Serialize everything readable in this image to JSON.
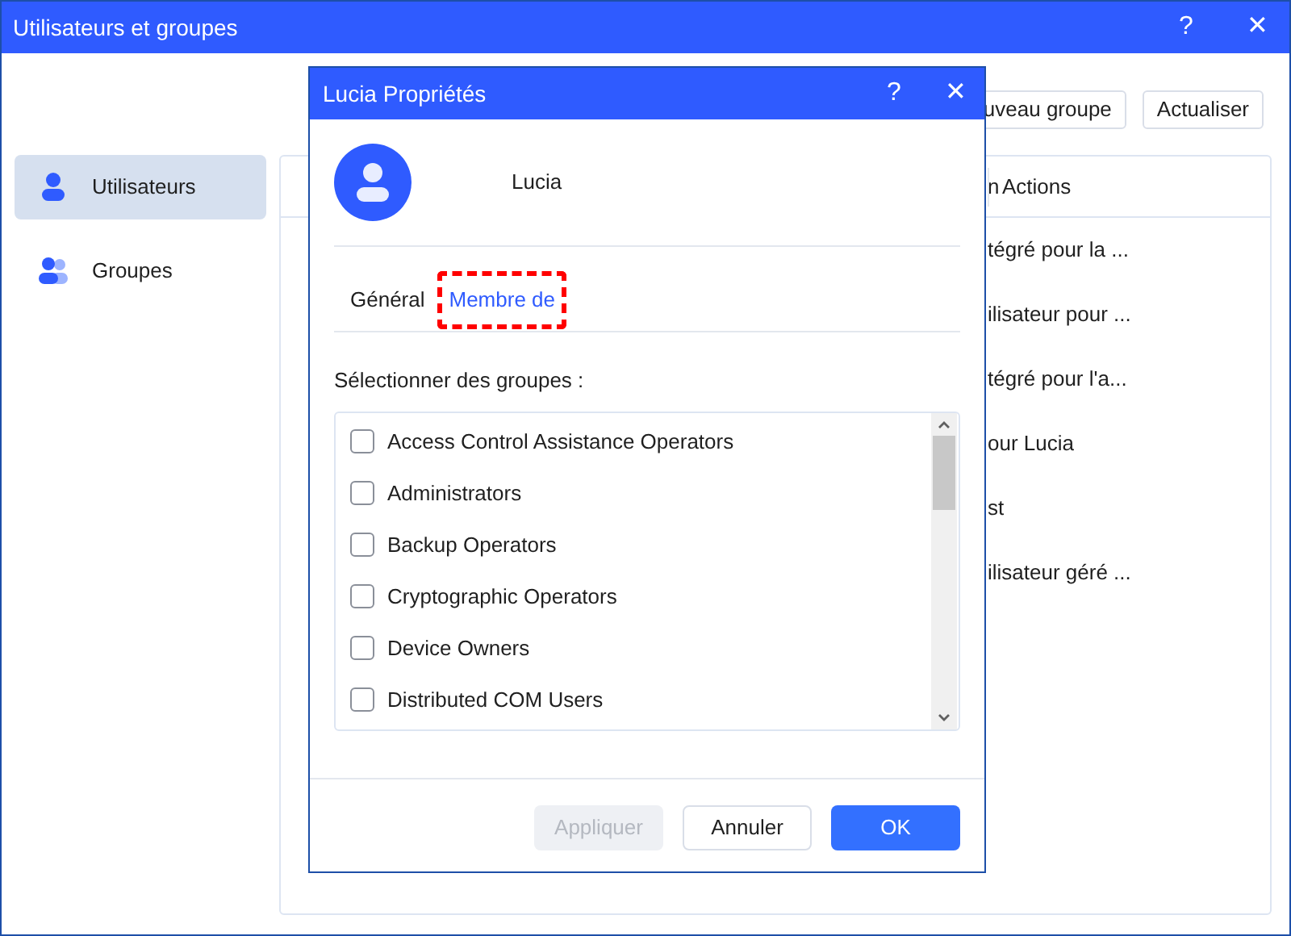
{
  "window": {
    "title": "Utilisateurs et groupes",
    "help": "?",
    "close": "✕"
  },
  "toolbar": {
    "buttons": [
      "uveau groupe",
      "Actualiser"
    ]
  },
  "sidebar": {
    "items": [
      {
        "label": "Utilisateurs",
        "kind": "user",
        "selected": true
      },
      {
        "label": "Groupes",
        "kind": "group",
        "selected": false
      }
    ]
  },
  "table": {
    "columns": [
      "n",
      "Actions"
    ],
    "rows": [
      "tégré pour la ...",
      "ilisateur pour ...",
      "tégré pour l'a...",
      "our Lucia",
      "st",
      "ilisateur géré ..."
    ]
  },
  "dialog": {
    "title": "Lucia Propriétés",
    "help": "?",
    "close": "✕",
    "user_name": "Lucia",
    "tabs": [
      {
        "label": "Général",
        "selected": false,
        "highlighted": false
      },
      {
        "label": "Membre de",
        "selected": true,
        "highlighted": true
      }
    ],
    "groups_label": "Sélectionner des groupes :",
    "groups": [
      {
        "label": "Access Control Assistance Operators",
        "checked": false
      },
      {
        "label": "Administrators",
        "checked": false
      },
      {
        "label": "Backup Operators",
        "checked": false
      },
      {
        "label": "Cryptographic Operators",
        "checked": false
      },
      {
        "label": "Device Owners",
        "checked": false
      },
      {
        "label": "Distributed COM Users",
        "checked": false
      }
    ],
    "buttons": [
      {
        "label": "Appliquer",
        "kind": "disabled"
      },
      {
        "label": "Annuler",
        "kind": "secondary"
      },
      {
        "label": "OK",
        "kind": "primary"
      }
    ]
  }
}
